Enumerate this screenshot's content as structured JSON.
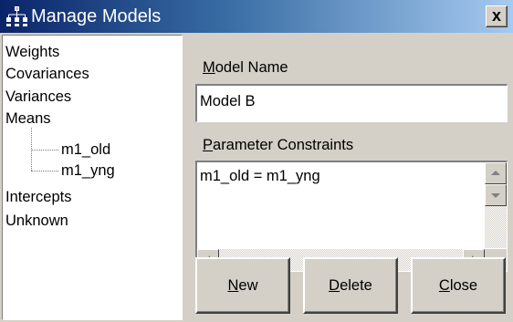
{
  "window": {
    "title": "Manage Models",
    "close_label": "x"
  },
  "tree": {
    "items": [
      {
        "label": "Weights"
      },
      {
        "label": "Covariances"
      },
      {
        "label": "Variances"
      },
      {
        "label": "Means"
      },
      {
        "label": "Intercepts"
      },
      {
        "label": "Unknown"
      }
    ],
    "means_children": [
      {
        "label": "m1_old"
      },
      {
        "label": "m1_yng"
      }
    ]
  },
  "form": {
    "model_name_label_mnemonic": "M",
    "model_name_label_rest": "odel Name",
    "model_name_value": "Model B",
    "constraints_label_mnemonic": "P",
    "constraints_label_rest": "arameter Constraints",
    "constraints_value": "m1_old = m1_yng"
  },
  "buttons": {
    "new_mnemonic": "N",
    "new_rest": "ew",
    "delete_mnemonic": "D",
    "delete_rest": "elete",
    "close_mnemonic": "C",
    "close_rest": "lose"
  },
  "colors": {
    "title_bar_start": "#0a246a",
    "title_bar_end": "#a6caf0",
    "dialog_face": "#d4d0c8"
  }
}
